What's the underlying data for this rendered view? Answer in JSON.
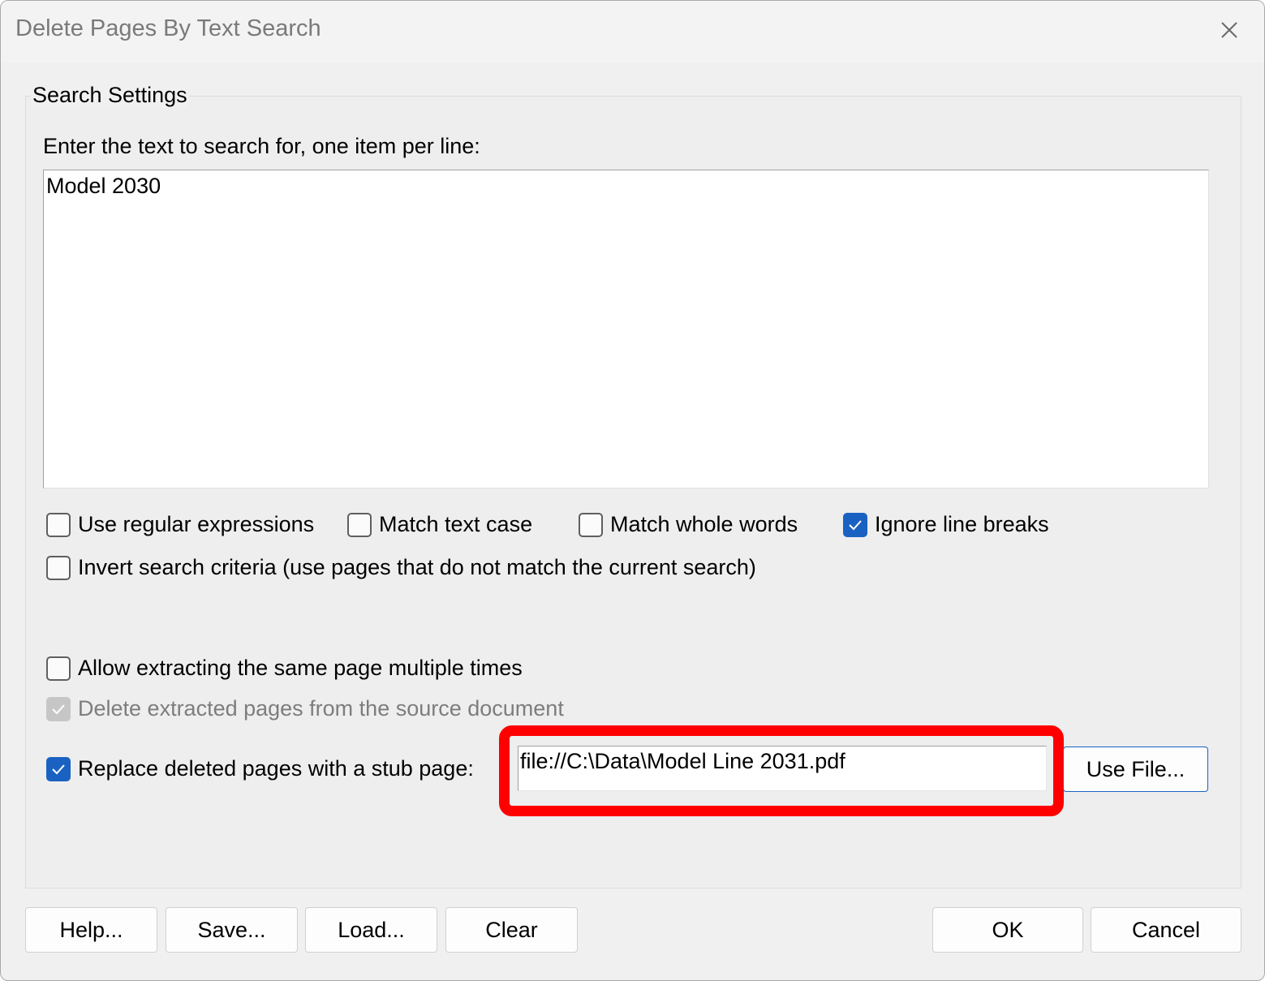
{
  "window": {
    "title": "Delete Pages By Text Search",
    "close_icon": "close-icon"
  },
  "search_settings": {
    "group_label": "Search Settings",
    "prompt": "Enter the text to search for, one item per line:",
    "search_text": "Model 2030"
  },
  "options": {
    "use_regex": {
      "label": "Use regular expressions",
      "checked": false
    },
    "match_case": {
      "label": "Match text case",
      "checked": false
    },
    "match_whole_words": {
      "label": "Match whole words",
      "checked": false
    },
    "ignore_line_breaks": {
      "label": "Ignore line breaks",
      "checked": true
    },
    "invert_criteria": {
      "label": "Invert search criteria (use pages that do not match the current search)",
      "checked": false
    },
    "allow_multiple": {
      "label": "Allow extracting the same page multiple times",
      "checked": false
    },
    "delete_extracted": {
      "label": "Delete extracted pages from the source document",
      "checked": true,
      "enabled": false
    },
    "replace_stub": {
      "label": "Replace deleted pages with a stub page:",
      "checked": true
    }
  },
  "stub_file": {
    "value": "file://C:\\Data\\Model Line 2031.pdf",
    "use_file_label": "Use File..."
  },
  "footer": {
    "help_label": "Help...",
    "save_label": "Save...",
    "load_label": "Load...",
    "clear_label": "Clear",
    "ok_label": "OK",
    "cancel_label": "Cancel"
  },
  "colors": {
    "accent": "#1a62c2",
    "highlight": "#ff0000",
    "dialog_bg": "#f0f0f0"
  }
}
